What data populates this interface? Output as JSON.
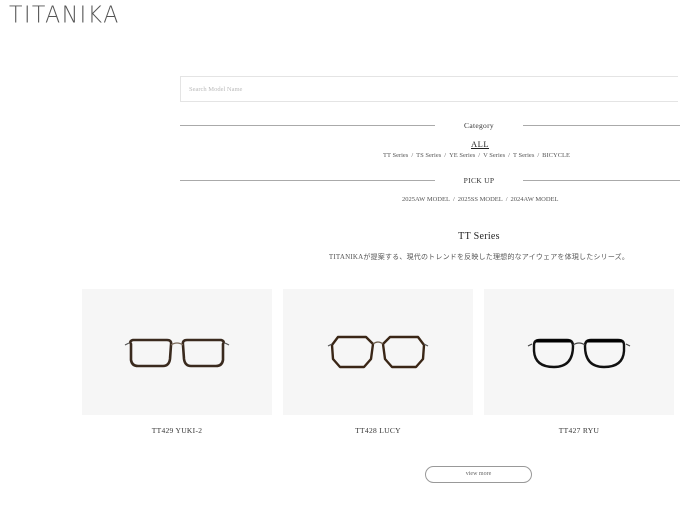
{
  "header": {
    "logo": "TITANIKA"
  },
  "search": {
    "placeholder": "Search Model Name"
  },
  "category": {
    "heading": "Category",
    "all_label": "ALL",
    "items": [
      "TT Series",
      "TS Series",
      "YE Series",
      "V Series",
      "T Series",
      "BICYCLE"
    ]
  },
  "pickup": {
    "heading": "PICK UP",
    "items": [
      "2025AW MODEL",
      "2025SS MODEL",
      "2024AW MODEL"
    ]
  },
  "section": {
    "title": "TT Series",
    "description": "TITANIKAが提案する、現代のトレンドを反映した理想的なアイウェアを体現したシリーズ。"
  },
  "products": [
    {
      "name": "TT429 YUKI-2",
      "frame_color": "#3a2a1e",
      "frame_style": "tortoise-rectangular"
    },
    {
      "name": "TT428 LUCY",
      "frame_color": "#3a2616",
      "frame_style": "tortoise-octagonal"
    },
    {
      "name": "TT427 RYU",
      "frame_color": "#111111",
      "frame_style": "black-round"
    }
  ],
  "buttons": {
    "view_more": "view more"
  },
  "separator": "/"
}
